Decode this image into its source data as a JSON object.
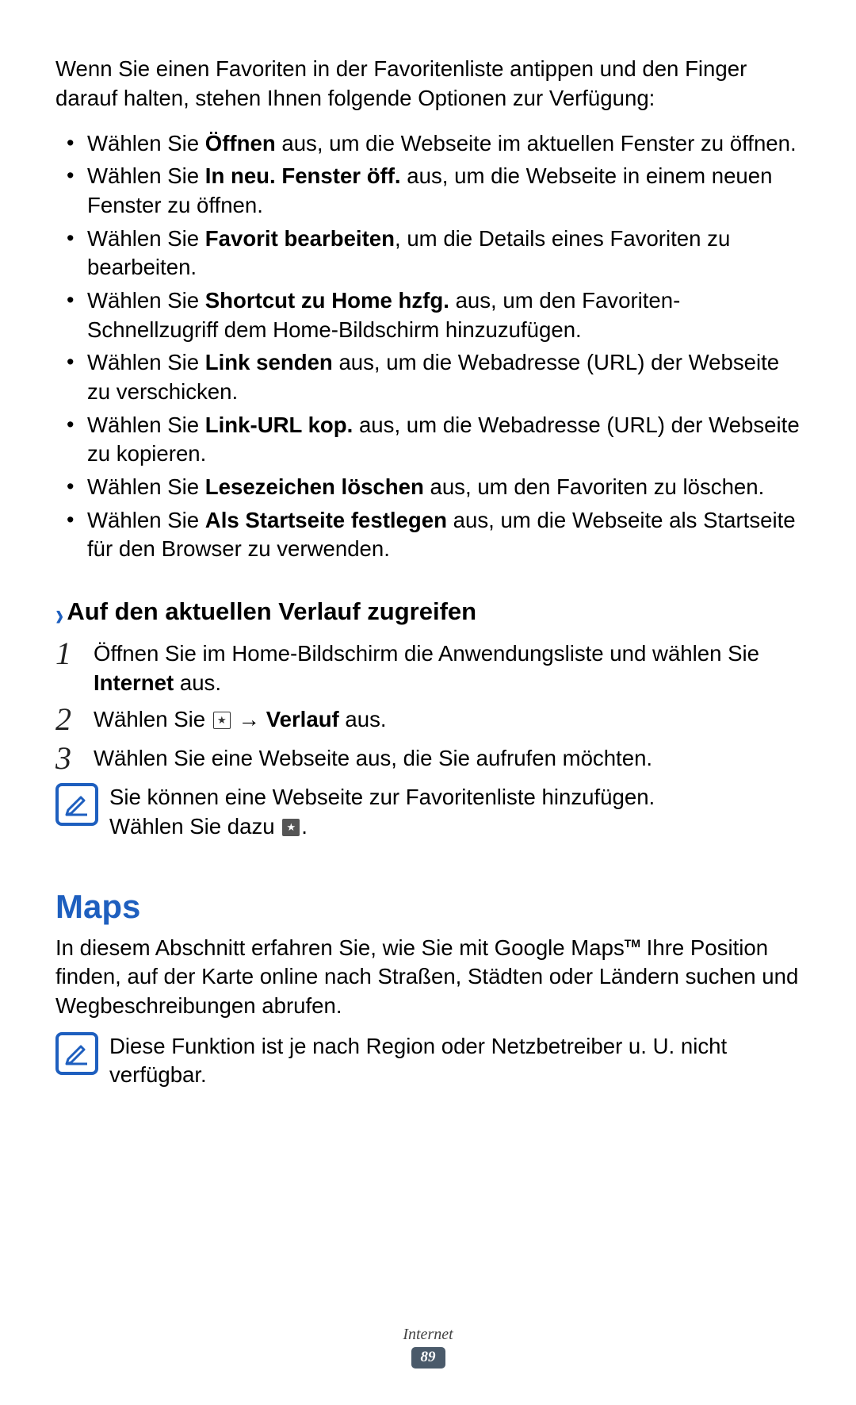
{
  "intro": "Wenn Sie einen Favoriten in der Favoritenliste antippen und den Finger darauf halten, stehen Ihnen folgende Optionen zur Verfügung:",
  "bullets": [
    {
      "pre": "Wählen Sie ",
      "bold": "Öffnen",
      "post": " aus, um die Webseite im aktuellen Fenster zu öffnen."
    },
    {
      "pre": "Wählen Sie ",
      "bold": "In neu. Fenster öff.",
      "post": " aus, um die Webseite in einem neuen Fenster zu öffnen."
    },
    {
      "pre": "Wählen Sie ",
      "bold": "Favorit bearbeiten",
      "post": ", um die Details eines Favoriten zu bearbeiten."
    },
    {
      "pre": "Wählen Sie ",
      "bold": "Shortcut zu Home hzfg.",
      "post": " aus, um den Favoriten-Schnellzugriff dem Home-Bildschirm hinzuzufügen."
    },
    {
      "pre": "Wählen Sie ",
      "bold": "Link senden",
      "post": " aus, um die Webadresse (URL) der Webseite zu verschicken."
    },
    {
      "pre": "Wählen Sie ",
      "bold": "Link-URL kop.",
      "post": " aus, um die Webadresse (URL) der Webseite zu kopieren."
    },
    {
      "pre": "Wählen Sie ",
      "bold": "Lesezeichen löschen",
      "post": " aus, um den Favoriten zu löschen."
    },
    {
      "pre": "Wählen Sie ",
      "bold": "Als Startseite festlegen",
      "post": " aus, um die Webseite als Startseite für den Browser zu verwenden."
    }
  ],
  "subhead": "Auf den aktuellen Verlauf zugreifen",
  "steps": {
    "s1_pre": "Öffnen Sie im Home-Bildschirm die Anwendungsliste und wählen Sie ",
    "s1_bold": "Internet",
    "s1_post": " aus.",
    "s2_pre": "Wählen Sie ",
    "s2_arrow": " → ",
    "s2_bold": "Verlauf",
    "s2_post": " aus.",
    "s3": "Wählen Sie eine Webseite aus, die Sie aufrufen möchten."
  },
  "note1_line1": "Sie können eine Webseite zur Favoritenliste hinzufügen. ",
  "note1_line2a": "Wählen Sie dazu ",
  "note1_line2b": ".",
  "maps_title": "Maps",
  "maps_intro_a": "In diesem Abschnitt erfahren Sie, wie Sie mit Google Maps",
  "maps_tm": "TM",
  "maps_intro_b": " Ihre Position finden, auf der Karte online nach Straßen, Städten oder Ländern suchen und Wegbeschreibungen abrufen.",
  "note2": "Diese Funktion ist je nach Region oder Netzbetreiber u. U. nicht verfügbar.",
  "footer_category": "Internet",
  "footer_page": "89"
}
